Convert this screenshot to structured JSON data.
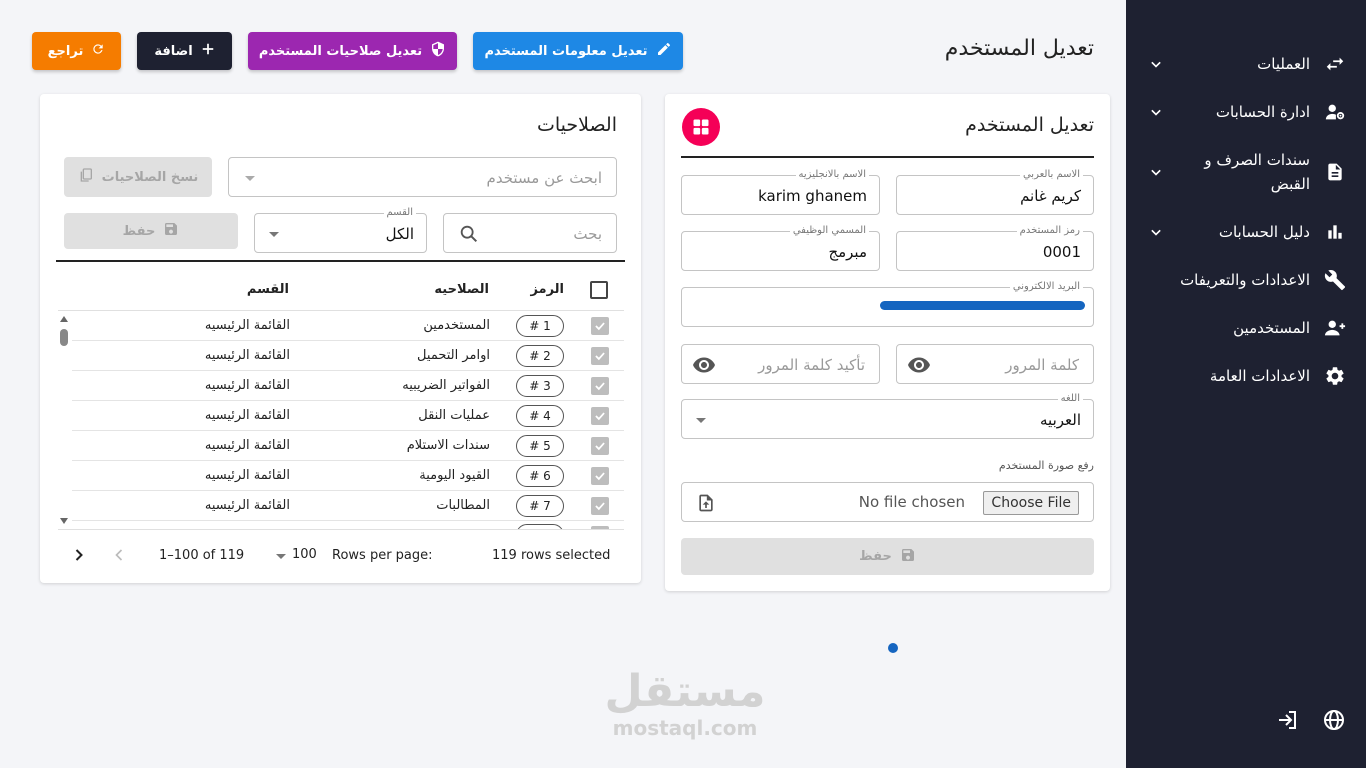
{
  "sidebar": {
    "items": [
      {
        "label": "العمليات",
        "icon": "swap-arrows-icon",
        "has_chevron": true
      },
      {
        "label": "ادارة الحسابات",
        "icon": "user-gear-icon",
        "has_chevron": true
      },
      {
        "label": "سندات الصرف و",
        "label2": "القبض",
        "icon": "document-icon",
        "has_chevron": true
      },
      {
        "label": "دليل الحسابات",
        "icon": "bar-chart-icon",
        "has_chevron": true
      },
      {
        "label": "الاعدادات والتعريفات",
        "icon": "wrench-icon",
        "has_chevron": false
      },
      {
        "label": "المستخدمين",
        "icon": "add-user-icon",
        "has_chevron": false
      },
      {
        "label": "الاعدادات العامة",
        "icon": "gear-icon",
        "has_chevron": false
      }
    ],
    "bottom": {
      "globe_icon": "globe-icon",
      "logout_icon": "logout-icon"
    }
  },
  "header": {
    "title": "تعديل المستخدم",
    "buttons": {
      "edit_info": "تعديل معلومات المستخدم",
      "edit_permissions": "تعديل صلاحيات المستخدم",
      "add": "اضافة",
      "back": "تراجع"
    }
  },
  "user_form": {
    "title": "تعديل المستخدم",
    "name_ar": {
      "label": "الاسم بالعربي",
      "value": "كريم غانم"
    },
    "name_en": {
      "label": "الاسم بالانجليزيه",
      "value": "karim ghanem"
    },
    "user_code": {
      "label": "رمز المستخدم",
      "value": "0001"
    },
    "job_title": {
      "label": "المسمي الوظيفي",
      "value": "مبرمج"
    },
    "email": {
      "label": "البريد الالكتروني"
    },
    "password": {
      "placeholder": "كلمة المرور"
    },
    "password_confirm": {
      "placeholder": "تأكيد كلمة المرور"
    },
    "language": {
      "label": "اللغه",
      "value": "العربيه"
    },
    "upload_label": "رفع صورة المستخدم",
    "file": {
      "button": "Choose File",
      "status": "No file chosen"
    },
    "save": "حفظ"
  },
  "permissions": {
    "title": "الصلاحيات",
    "user_search_placeholder": "ابحث عن مستخدم",
    "copy_button": "نسخ الصلاحيات",
    "search_placeholder": "بحث",
    "section": {
      "label": "القسم",
      "value": "الكل"
    },
    "save": "حفظ",
    "columns": {
      "code": "الرمز",
      "permission": "الصلاحيه",
      "section": "القسم"
    },
    "rows": [
      {
        "code": "# 1",
        "permission": "المستخدمين",
        "section": "القائمة الرئيسيه"
      },
      {
        "code": "# 2",
        "permission": "اوامر التحميل",
        "section": "القائمة الرئيسيه"
      },
      {
        "code": "# 3",
        "permission": "الفواتير الضريبيه",
        "section": "القائمة الرئيسيه"
      },
      {
        "code": "# 4",
        "permission": "عمليات النقل",
        "section": "القائمة الرئيسيه"
      },
      {
        "code": "# 5",
        "permission": "سندات الاستلام",
        "section": "القائمة الرئيسيه"
      },
      {
        "code": "# 6",
        "permission": "القيود اليومية",
        "section": "القائمة الرئيسيه"
      },
      {
        "code": "# 7",
        "permission": "المطالبات",
        "section": "القائمة الرئيسيه"
      }
    ],
    "footer": {
      "selected": "119 rows selected",
      "rows_per_page_label": "Rows per page:",
      "rows_per_page": "100",
      "range": "1–100 of 119"
    }
  },
  "watermark": {
    "text": "مستقل",
    "sub": "mostaql.com"
  },
  "colors": {
    "sidebar_bg": "#1e2131",
    "edit_info": "#1e88e5",
    "edit_permissions": "#9c27b0",
    "add": "#1e2131",
    "back": "#f57c00",
    "accent_pink": "#f50057"
  }
}
